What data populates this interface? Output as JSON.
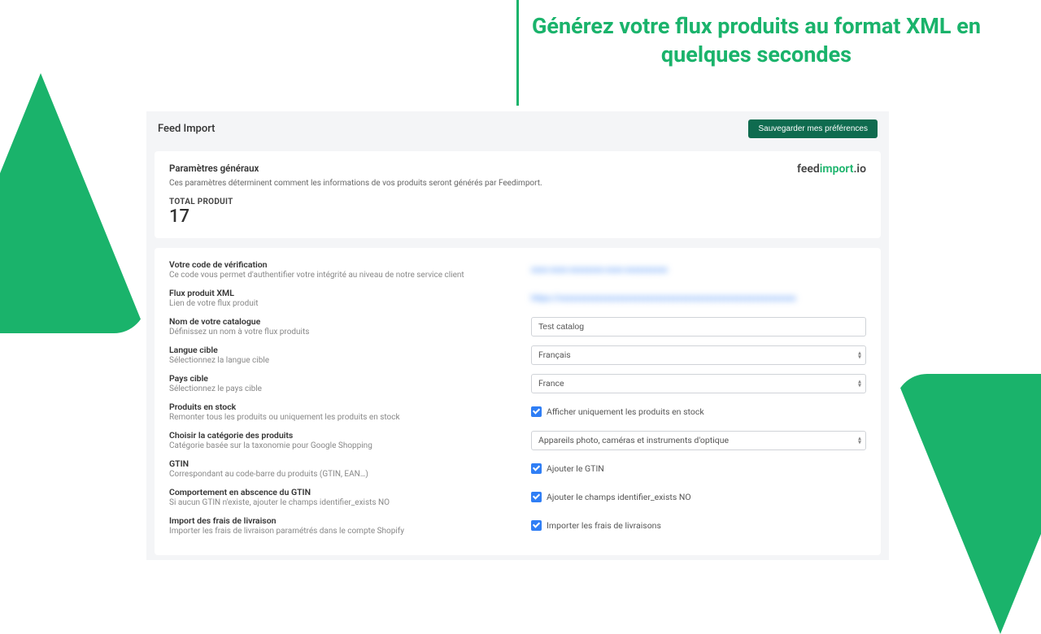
{
  "hero": {
    "title": "Générez votre flux produits au format XML en quelques secondes"
  },
  "header": {
    "title": "Feed Import",
    "save_button": "Sauvegarder mes préférences"
  },
  "logo": {
    "part1": "feed",
    "part2": "import",
    "part3": ".io"
  },
  "general": {
    "title": "Paramètres généraux",
    "description": "Ces paramètres déterminent comment les informations de vos produits seront générés par Feedimport.",
    "total_label": "TOTAL PRODUIT",
    "total_value": "17"
  },
  "rows": {
    "verification": {
      "label": "Votre code de vérification",
      "hint": "Ce code vous permet d'authentifier votre intégrité au niveau de notre service client",
      "blurred": "xxxx-xxxx-xxxxxxxx-xxxx-xxxxxxxxxx"
    },
    "xml": {
      "label": "Flux produit XML",
      "hint": "Lien de votre flux produit",
      "blurred": "https://xxxxxxxxxxxxxxxxxxxxxxxxxxxxxxxxxxxxxxxxxxxxxxxxxxxxxxxx"
    },
    "catalog": {
      "label": "Nom de votre catalogue",
      "hint": "Définissez un nom à votre flux produits",
      "value": "Test catalog"
    },
    "lang": {
      "label": "Langue cible",
      "hint": "Sélectionnez la langue cible",
      "value": "Français"
    },
    "country": {
      "label": "Pays cible",
      "hint": "Sélectionnez le pays cible",
      "value": "France"
    },
    "stock": {
      "label": "Produits en stock",
      "hint": "Remonter tous les produits ou uniquement les produits en stock",
      "check": "Afficher uniquement les produits en stock"
    },
    "category": {
      "label": "Choisir la catégorie des produits",
      "hint": "Catégorie basée sur la taxonomie pour Google Shopping",
      "value": "Appareils photo, caméras et instruments d'optique"
    },
    "gtin": {
      "label": "GTIN",
      "hint": "Correspondant au code-barre du produits (GTIN, EAN…)",
      "check": "Ajouter le GTIN"
    },
    "identifier": {
      "label": "Comportement en abscence du GTIN",
      "hint": "Si aucun GTIN n'existe, ajouter le champs identifier_exists NO",
      "check": "Ajouter le champs identifier_exists NO"
    },
    "shipping": {
      "label": "Import des frais de livraison",
      "hint": "Importer les frais de livraison paramétrés dans le compte Shopify",
      "check": "Importer les frais de livraisons"
    }
  }
}
